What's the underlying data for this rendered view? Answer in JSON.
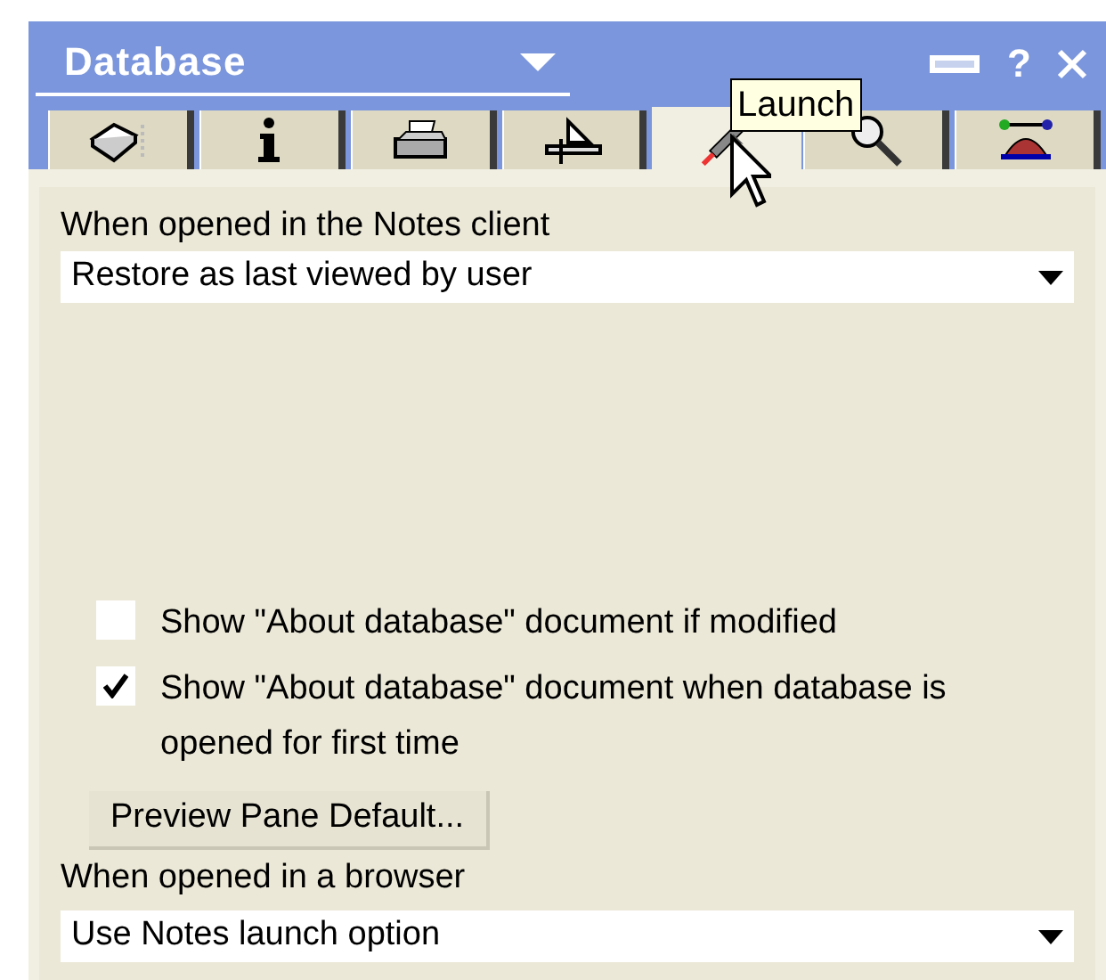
{
  "window": {
    "title": "Database",
    "help": "?"
  },
  "tabs": [
    {
      "kind": "book",
      "selected": false
    },
    {
      "kind": "info",
      "selected": false
    },
    {
      "kind": "printer",
      "selected": false
    },
    {
      "kind": "ruler",
      "selected": false
    },
    {
      "kind": "rocket",
      "selected": true
    },
    {
      "kind": "magnifier",
      "selected": false
    },
    {
      "kind": "hat",
      "selected": false
    }
  ],
  "tooltip": "Launch",
  "notes_client": {
    "label": "When opened in the Notes client",
    "value": "Restore as last viewed by user"
  },
  "checkboxes": [
    {
      "label": "Show \"About database\" document if modified",
      "checked": false
    },
    {
      "label": "Show \"About database\" document when database is opened for first time",
      "checked": true
    }
  ],
  "button": "Preview Pane Default...",
  "browser": {
    "label": "When opened in a browser",
    "value": "Use Notes launch option"
  }
}
